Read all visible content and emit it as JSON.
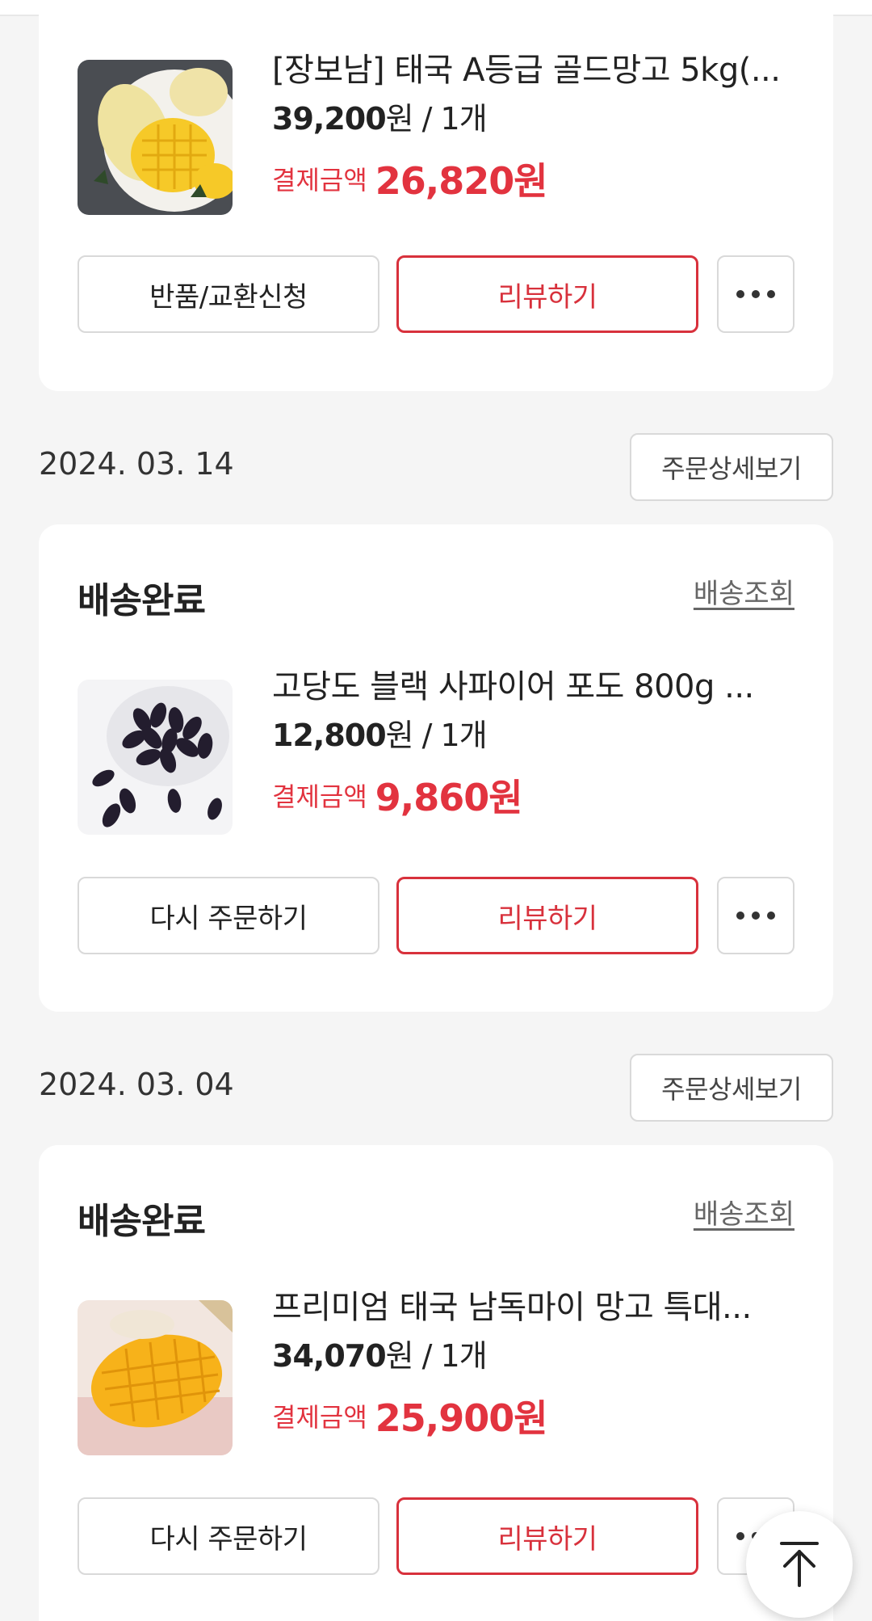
{
  "common": {
    "review_label": "리뷰하기",
    "detail_label": "주문상세보기",
    "track_label": "배송조회",
    "pay_label": "결제금액"
  },
  "orders": [
    {
      "product": {
        "name": "[장보남] 태국 A등급 골드망고 5kg(...",
        "price": "39,200",
        "price_suffix": "원 / 1개",
        "pay_amount": "26,820원"
      },
      "left_button": "반품/교환신청"
    },
    {
      "date": "2024. 03. 14",
      "status": "배송완료",
      "product": {
        "name": "고당도 블랙 사파이어 포도 800g ...",
        "price": "12,800",
        "price_suffix": "원 / 1개",
        "pay_amount": "9,860원"
      },
      "left_button": "다시 주문하기"
    },
    {
      "date": "2024. 03. 04",
      "status": "배송완료",
      "product": {
        "name": "프리미엄 태국 남독마이 망고 특대...",
        "price": "34,070",
        "price_suffix": "원 / 1개",
        "pay_amount": "25,900원"
      },
      "left_button": "다시 주문하기"
    }
  ],
  "icons": {
    "more": "more-dots-icon",
    "scroll_top": "arrow-up-to-top-icon"
  },
  "colors": {
    "accent": "#d8313c",
    "background": "#f5f5f5"
  }
}
